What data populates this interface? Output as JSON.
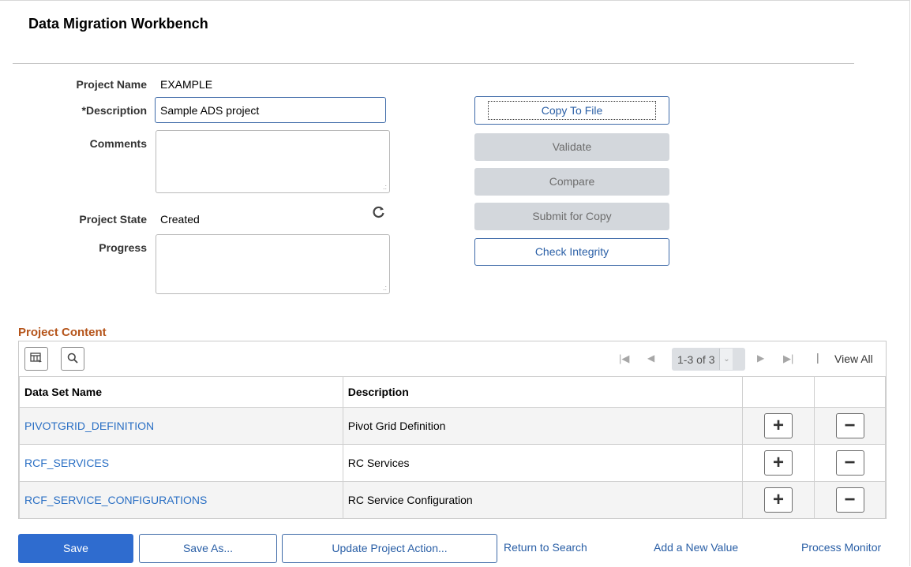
{
  "page": {
    "title": "Data Migration Workbench"
  },
  "form": {
    "project_name_label": "Project Name",
    "project_name_value": "EXAMPLE",
    "description_label": "*Description",
    "description_value": "Sample ADS project",
    "comments_label": "Comments",
    "comments_value": "",
    "project_state_label": "Project State",
    "project_state_value": "Created",
    "progress_label": "Progress",
    "progress_value": ""
  },
  "actions": {
    "copy_to_file": "Copy To File",
    "validate": "Validate",
    "compare": "Compare",
    "submit_for_copy": "Submit for Copy",
    "check_integrity": "Check Integrity"
  },
  "grid": {
    "section_title": "Project Content",
    "pager_range": "1-3 of 3",
    "view_all": "View All",
    "columns": [
      "Data Set Name",
      "Description"
    ],
    "rows": [
      {
        "name": "PIVOTGRID_DEFINITION",
        "description": "Pivot Grid Definition"
      },
      {
        "name": "RCF_SERVICES",
        "description": "RC Services"
      },
      {
        "name": "RCF_SERVICE_CONFIGURATIONS",
        "description": "RC Service Configuration"
      }
    ]
  },
  "footer": {
    "save": "Save",
    "save_as": "Save As...",
    "update_project_action": "Update Project Action...",
    "return_to_search": "Return to Search",
    "add_new_value": "Add a New Value",
    "process_monitor": "Process Monitor"
  },
  "colors": {
    "primary": "#2f6ccf",
    "link": "#2a6fc4",
    "section_title": "#b5541a",
    "disabled_button": "#d3d7dc"
  },
  "icons": [
    "refresh-icon",
    "personalize-grid-icon",
    "search-icon",
    "first-page-icon",
    "previous-page-icon",
    "next-page-icon",
    "last-page-icon",
    "chevron-down-icon",
    "add-row-icon",
    "delete-row-icon"
  ]
}
